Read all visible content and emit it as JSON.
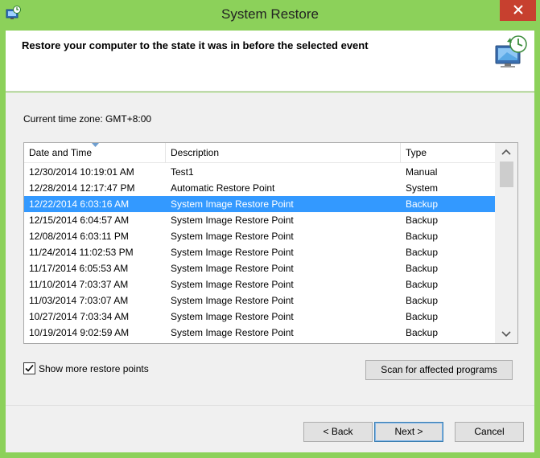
{
  "window": {
    "title": "System Restore",
    "accent_color": "#8cd15a",
    "close_color": "#c7402f"
  },
  "header": {
    "title": "Restore your computer to the state it was in before the selected event",
    "icon": "system-restore-monitor-icon"
  },
  "timezone": {
    "text": "Current time zone: GMT+8:00"
  },
  "list": {
    "columns": [
      "Date and Time",
      "Description",
      "Type"
    ],
    "sorted_column": "Date and Time",
    "selected_row": 2,
    "selection_color": "#3399ff",
    "rows": [
      {
        "date": "12/30/2014 10:19:01 AM",
        "description": "Test1",
        "type": "Manual"
      },
      {
        "date": "12/28/2014 12:17:47 PM",
        "description": "Automatic Restore Point",
        "type": "System"
      },
      {
        "date": "12/22/2014 6:03:16 AM",
        "description": "System Image Restore Point",
        "type": "Backup"
      },
      {
        "date": "12/15/2014 6:04:57 AM",
        "description": "System Image Restore Point",
        "type": "Backup"
      },
      {
        "date": "12/08/2014 6:03:11 PM",
        "description": "System Image Restore Point",
        "type": "Backup"
      },
      {
        "date": "11/24/2014 11:02:53 PM",
        "description": "System Image Restore Point",
        "type": "Backup"
      },
      {
        "date": "11/17/2014 6:05:53 AM",
        "description": "System Image Restore Point",
        "type": "Backup"
      },
      {
        "date": "11/10/2014 7:03:37 AM",
        "description": "System Image Restore Point",
        "type": "Backup"
      },
      {
        "date": "11/03/2014 7:03:07 AM",
        "description": "System Image Restore Point",
        "type": "Backup"
      },
      {
        "date": "10/27/2014 7:03:34 AM",
        "description": "System Image Restore Point",
        "type": "Backup"
      },
      {
        "date": "10/19/2014 9:02:59 AM",
        "description": "System Image Restore Point",
        "type": "Backup"
      }
    ]
  },
  "options": {
    "show_more_label": "Show more restore points",
    "show_more_checked": true,
    "scan_label": "Scan for affected programs"
  },
  "footer": {
    "back_label": "< Back",
    "next_label": "Next >",
    "cancel_label": "Cancel"
  }
}
